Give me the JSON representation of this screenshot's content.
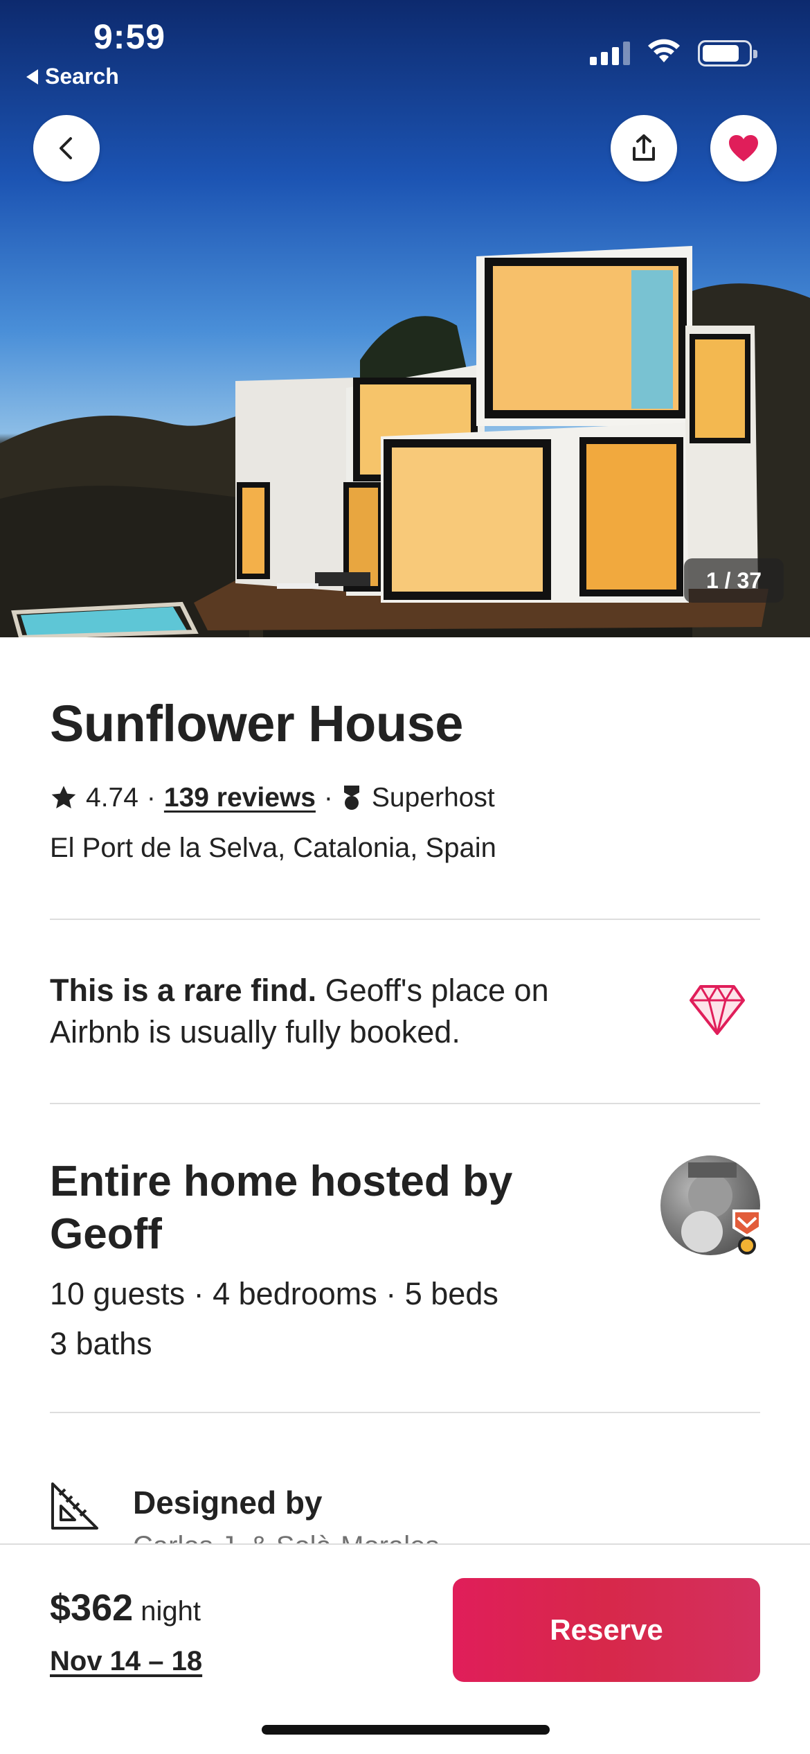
{
  "status_bar": {
    "time": "9:59",
    "back_app_label": "Search"
  },
  "hero": {
    "photo_counter": "1 / 37"
  },
  "listing": {
    "title": "Sunflower House",
    "rating": "4.74",
    "reviews_link": "139 reviews",
    "separator": "·",
    "superhost_label": "Superhost",
    "location": "El Port de la Selva, Catalonia, Spain"
  },
  "rare_find": {
    "bold": "This is a rare find.",
    "text": " Geoff's place on Airbnb is usually fully booked."
  },
  "host": {
    "title": "Entire home hosted by Geoff",
    "details_line1": "10 guests · 4 bedrooms · 5 beds",
    "details_line2": "3 baths"
  },
  "highlight": {
    "label": "Designed by",
    "sub": "Carlos J. & Solà-Morales"
  },
  "footer": {
    "price": "$362",
    "price_unit": "night",
    "dates": "Nov 14 – 18",
    "reserve_label": "Reserve"
  },
  "colors": {
    "brand": "#E01E5A",
    "text": "#222222",
    "muted": "#717171",
    "divider": "#DDDDDD"
  }
}
